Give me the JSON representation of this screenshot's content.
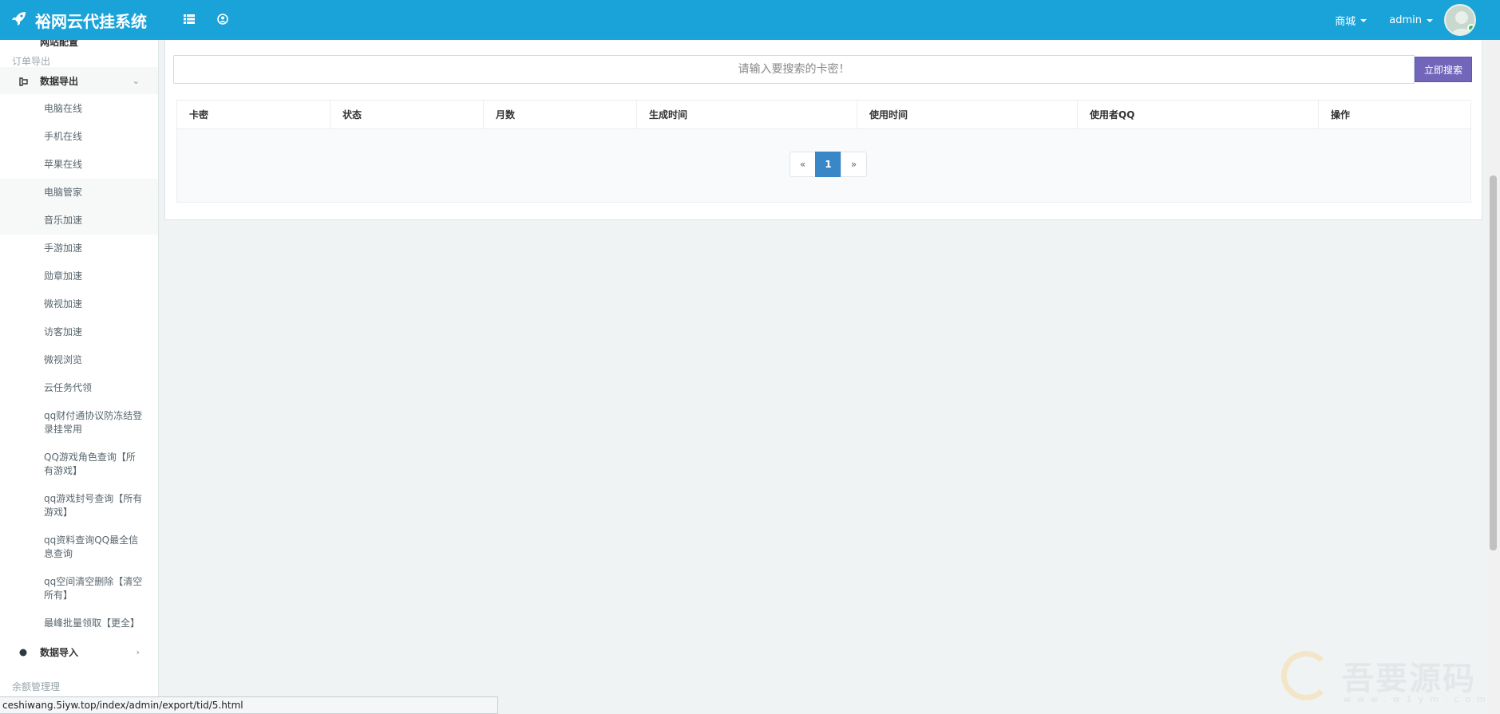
{
  "header": {
    "brand": "裕网云代挂系统",
    "shop_label": "商城",
    "user_label": "admin",
    "colors": {
      "bg": "#1aa3d9",
      "accent": "#7266ba"
    }
  },
  "sidebar": {
    "cut_item": "网站配置",
    "section_order": "订单导出",
    "export_group": "数据导出",
    "export_items": [
      "电脑在线",
      "手机在线",
      "苹果在线",
      "电脑管家",
      "音乐加速",
      "手游加速",
      "勋章加速",
      "微视加速",
      "访客加速",
      "微视浏览",
      "云任务代领",
      "qq财付通协议防冻结登录挂常用",
      "QQ游戏角色查询【所有游戏】",
      "qq游戏封号查询【所有游戏】",
      "qq资料查询QQ最全信息查询",
      "qq空间清空删除【清空所有】",
      "最峰批量领取【更全】"
    ],
    "import_group": "数据导入",
    "section_balance": "余额管理理"
  },
  "search": {
    "placeholder": "请输入要搜索的卡密！",
    "button": "立即搜索"
  },
  "table": {
    "columns": [
      "卡密",
      "状态",
      "月数",
      "生成时间",
      "使用时间",
      "使用者QQ",
      "操作"
    ]
  },
  "pagination": {
    "prev": "«",
    "current": "1",
    "next": "»"
  },
  "status_bar": {
    "url": "ceshiwang.5iyw.top/index/admin/export/tid/5.html"
  },
  "watermark": {
    "text": "吾要源码",
    "sub": "www.w1ym.com"
  }
}
